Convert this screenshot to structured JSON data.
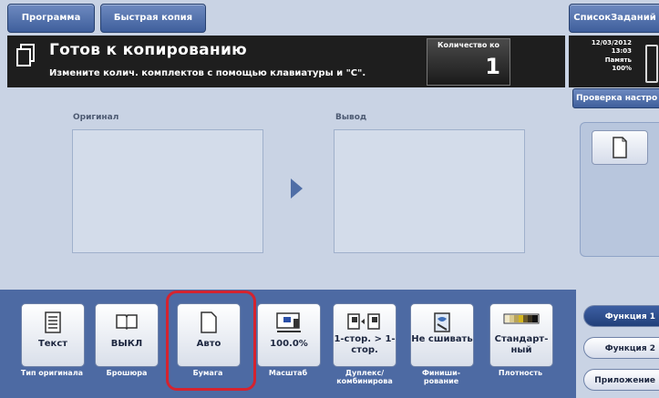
{
  "top_buttons": {
    "program": "Программа",
    "quick_copy": "Быстрая копия",
    "job_list": "СписокЗаданий"
  },
  "status": {
    "title": "Готов к копированию",
    "subtitle": "Измените колич. комплектов с помощью клавиатуры и \"С\".",
    "qty_label": "Количество ко",
    "qty_value": "1"
  },
  "info": {
    "date": "12/03/2012",
    "time": "13:03",
    "memory_label": "Память",
    "memory_value": "100%"
  },
  "check_settings": "Проверка настро",
  "preview": {
    "original_label": "Оригинал",
    "output_label": "Вывод"
  },
  "functions": [
    {
      "value": "Текст",
      "label": "Тип оригинала",
      "icon": "document-lines-icon"
    },
    {
      "value": "ВЫКЛ",
      "label": "Брошюра",
      "icon": "booklet-icon"
    },
    {
      "value": "Авто",
      "label": "Бумага",
      "icon": "paper-icon"
    },
    {
      "value": "100.0%",
      "label": "Масштаб",
      "icon": "zoom-icon"
    },
    {
      "value": "1-стор. > 1-стор.",
      "label": "Дуплекс/ комбинирова",
      "icon": "duplex-icon"
    },
    {
      "value": "Не сшивать",
      "label": "Финиши- рование",
      "icon": "finishing-icon"
    },
    {
      "value": "Стандарт- ный",
      "label": "Плотность",
      "icon": "density-icon"
    }
  ],
  "side_tabs": {
    "func1": "Функция 1",
    "func2": "Функция 2",
    "apps": "Приложение"
  },
  "colors": {
    "accent_blue": "#4d6aa3",
    "highlight_red": "#d4232f"
  }
}
